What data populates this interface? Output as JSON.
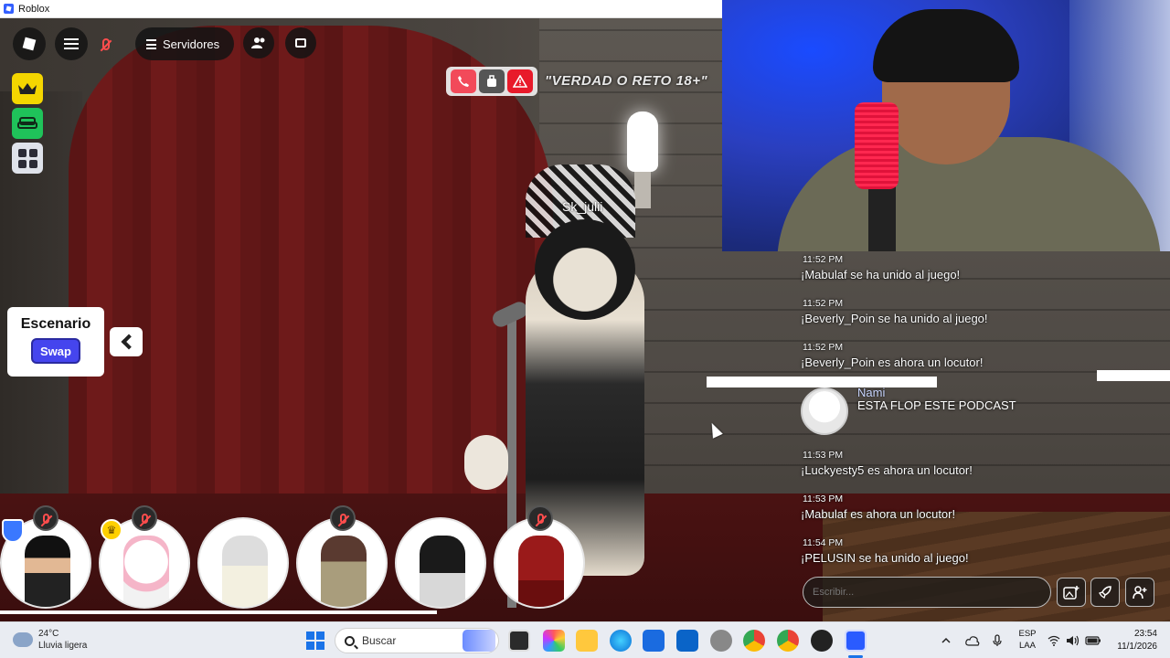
{
  "window": {
    "title": "Roblox"
  },
  "topbar": {
    "servers_label": "Servidores"
  },
  "game": {
    "title": "\"VERDAD O RETO 18+\"",
    "player_nametag": "Sk_julii"
  },
  "escenario": {
    "title": "Escenario",
    "swap_label": "Swap"
  },
  "chat": {
    "messages": [
      {
        "time": "11:52 PM",
        "text": "¡Mabulaf se ha unido al juego!"
      },
      {
        "time": "11:52 PM",
        "text": "¡Beverly_Poin se ha unido al juego!"
      },
      {
        "time": "11:52 PM",
        "text": "¡Beverly_Poin es ahora un locutor!"
      },
      {
        "time": "11:53 PM",
        "text": "¡Luckyesty5 es ahora un locutor!"
      },
      {
        "time": "11:53 PM",
        "text": "¡Mabulaf es ahora un locutor!"
      },
      {
        "time": "11:54 PM",
        "text": "¡PELUSIN se ha unido al juego!"
      }
    ],
    "user_message": {
      "name": "Nami",
      "text": "ESTA FLOP ESTE PODCAST"
    },
    "input_placeholder": "Escribir..."
  },
  "taskbar": {
    "weather_temp": "24°C",
    "weather_desc": "Lluvia ligera",
    "search_label": "Buscar",
    "lang_line1": "ESP",
    "lang_line2": "LAA",
    "time": "23:54",
    "date": "11/1/2026"
  },
  "colors": {
    "swap_button": "#4545ee",
    "crown_button": "#f4d600",
    "sofa_button": "#1fc35a",
    "hangup": "#f24a5a",
    "report": "#e81a2a"
  }
}
